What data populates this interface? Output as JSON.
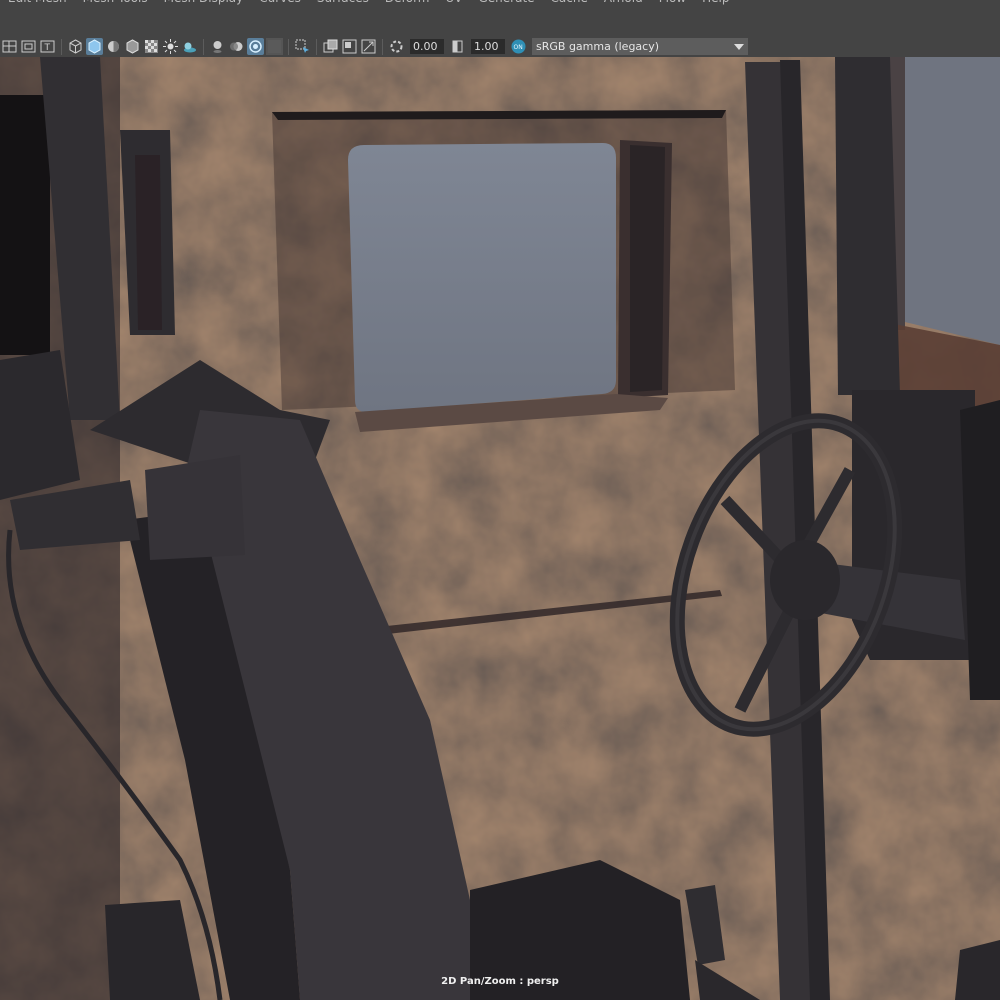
{
  "menubar": {
    "items": [
      "Edit Mesh",
      "Mesh Tools",
      "Mesh Display",
      "Curves",
      "Surfaces",
      "Deform",
      "UV",
      "Generate",
      "Cache",
      "Arnold",
      "Flow",
      "Help"
    ]
  },
  "toolbar": {
    "exposure_value": "0.00",
    "gamma_value": "1.00",
    "color_space": "sRGB gamma (legacy)",
    "icons": [
      "grid-icon",
      "film-gate-icon",
      "text-icon",
      "wireframe-cube-icon",
      "smooth-shade-icon",
      "flat-shade-icon",
      "bounding-box-icon",
      "textured-icon",
      "lights-icon",
      "shadows-icon",
      "ambient-occlusion-icon",
      "motion-blur-icon",
      "anti-aliasing-icon",
      "depth-of-field-icon",
      "isolate-select-icon",
      "xray-icon",
      "xray-joints-icon",
      "xray-active-icon",
      "exposure-icon",
      "gamma-icon",
      "color-management-icon"
    ]
  },
  "viewport": {
    "camera_label": "2D Pan/Zoom : persp"
  }
}
